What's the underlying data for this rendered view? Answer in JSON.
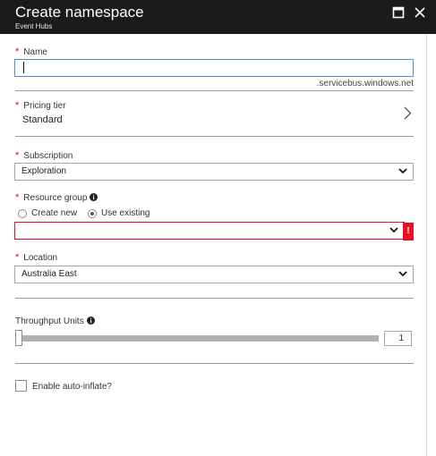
{
  "header": {
    "title": "Create namespace",
    "subtitle": "Event Hubs"
  },
  "form": {
    "required_mark": "*",
    "name": {
      "label": "Name",
      "value": "",
      "suffix": ".servicebus.windows.net"
    },
    "pricing_tier": {
      "label": "Pricing tier",
      "value": "Standard"
    },
    "subscription": {
      "label": "Subscription",
      "selected": "Exploration"
    },
    "resource_group": {
      "label": "Resource group",
      "option_create": "Create new",
      "option_existing": "Use existing",
      "selected_option": "Use existing",
      "selected": "",
      "error_mark": "!"
    },
    "location": {
      "label": "Location",
      "selected": "Australia East"
    },
    "throughput_units": {
      "label": "Throughput Units",
      "value": "1",
      "slider_fraction": 0
    },
    "auto_inflate": {
      "label": "Enable auto-inflate?",
      "checked": false
    }
  },
  "colors": {
    "header_bg": "#1b1b1b",
    "required": "#c8102e",
    "error": "#e81123",
    "focus": "#4a90d9"
  },
  "icons": {
    "maximize": "maximize-icon",
    "close": "close-icon",
    "info": "info-icon",
    "chevron_right": "chevron-right-icon",
    "chevron_down": "chevron-down-icon"
  }
}
